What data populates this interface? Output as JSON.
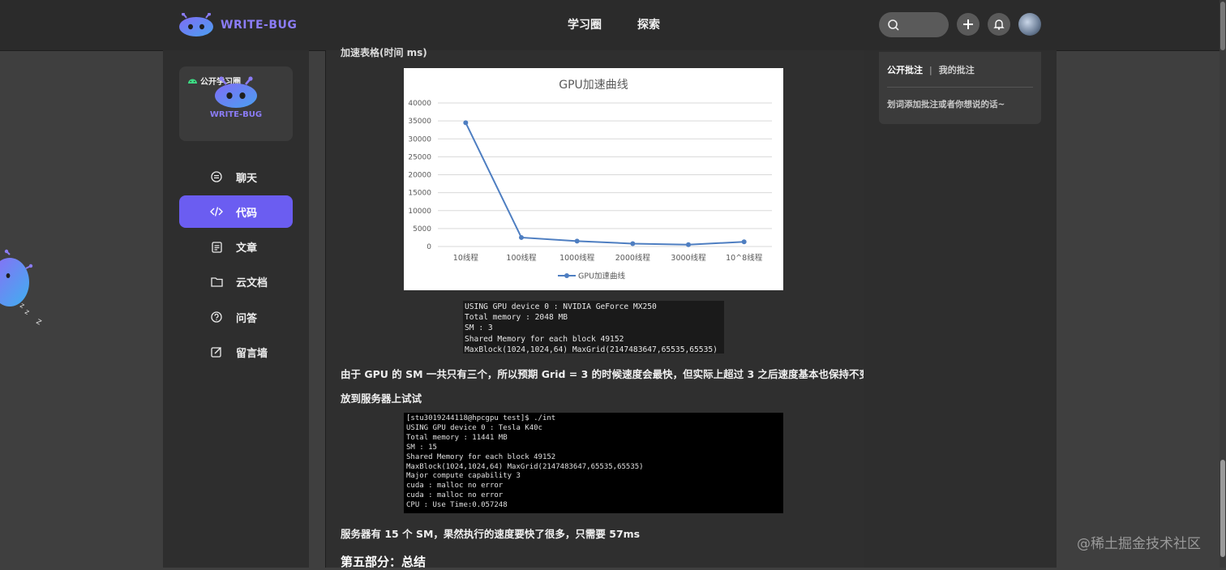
{
  "brand": {
    "name": "WRITE-BUG"
  },
  "nav": {
    "items": [
      "学习圈",
      "探索"
    ]
  },
  "header_actions": {
    "search_placeholder": ""
  },
  "circle_card": {
    "tag": "公开学习圈",
    "brand": "WRITE-BUG"
  },
  "menu": {
    "items": [
      {
        "label": "聊天",
        "icon": "chat-icon"
      },
      {
        "label": "代码",
        "icon": "code-icon",
        "active": true
      },
      {
        "label": "文章",
        "icon": "article-icon"
      },
      {
        "label": "云文档",
        "icon": "folder-icon"
      },
      {
        "label": "问答",
        "icon": "question-icon"
      },
      {
        "label": "留言墙",
        "icon": "edit-icon"
      }
    ]
  },
  "content": {
    "cut_heading": "加速表格(时间 ms)",
    "term1": [
      "USING GPU device 0 : NVIDIA GeForce MX250",
      "Total memory : 2048 MB",
      "SM : 3",
      "Shared Memory for each block 49152",
      "MaxBlock(1024,1024,64) MaxGrid(2147483647,65535,65535)"
    ],
    "para1": "由于 GPU 的 SM 一共只有三个，所以预期 Grid = 3 的时候速度会最快，但实际上超过 3 之后速度基本也保持不变",
    "para2": "放到服务器上试试",
    "term2": [
      "[stu3019244118@hpcgpu test]$ ./int",
      "USING GPU device 0 : Tesla K40c",
      "Total memory : 11441 MB",
      "SM : 15",
      "Shared Memory for each block 49152",
      "MaxBlock(1024,1024,64) MaxGrid(2147483647,65535,65535)",
      "Major compute capability 3",
      "cuda : malloc no error",
      "cuda : malloc no error",
      "CPU : Use Time:0.057248"
    ],
    "para3": "服务器有 15 个 SM，果然执行的速度要快了很多，只需要 57ms",
    "section_head": "第五部分：总结"
  },
  "chart_data": {
    "type": "line",
    "title": "GPU加速曲线",
    "categories": [
      "10线程",
      "100线程",
      "1000线程",
      "2000线程",
      "3000线程",
      "10^8线程"
    ],
    "series": [
      {
        "name": "GPU加速曲线",
        "values": [
          34500,
          2500,
          1500,
          800,
          500,
          1300
        ],
        "color": "#4e7ec1"
      }
    ],
    "ylim": [
      0,
      40000
    ],
    "yticks": [
      "40000",
      "35000",
      "30000",
      "25000",
      "20000",
      "15000",
      "10000",
      "5000",
      "0"
    ],
    "grid": true,
    "legend": "bottom"
  },
  "annotations": {
    "tab_public": "公开批注",
    "separator": "|",
    "tab_mine": "我的批注",
    "hint": "划词添加批注或者你想说的话~"
  },
  "watermark": "@稀土掘金技术社区",
  "colors": {
    "accent": "#6b5df1",
    "brand": "#8b7cf6"
  }
}
